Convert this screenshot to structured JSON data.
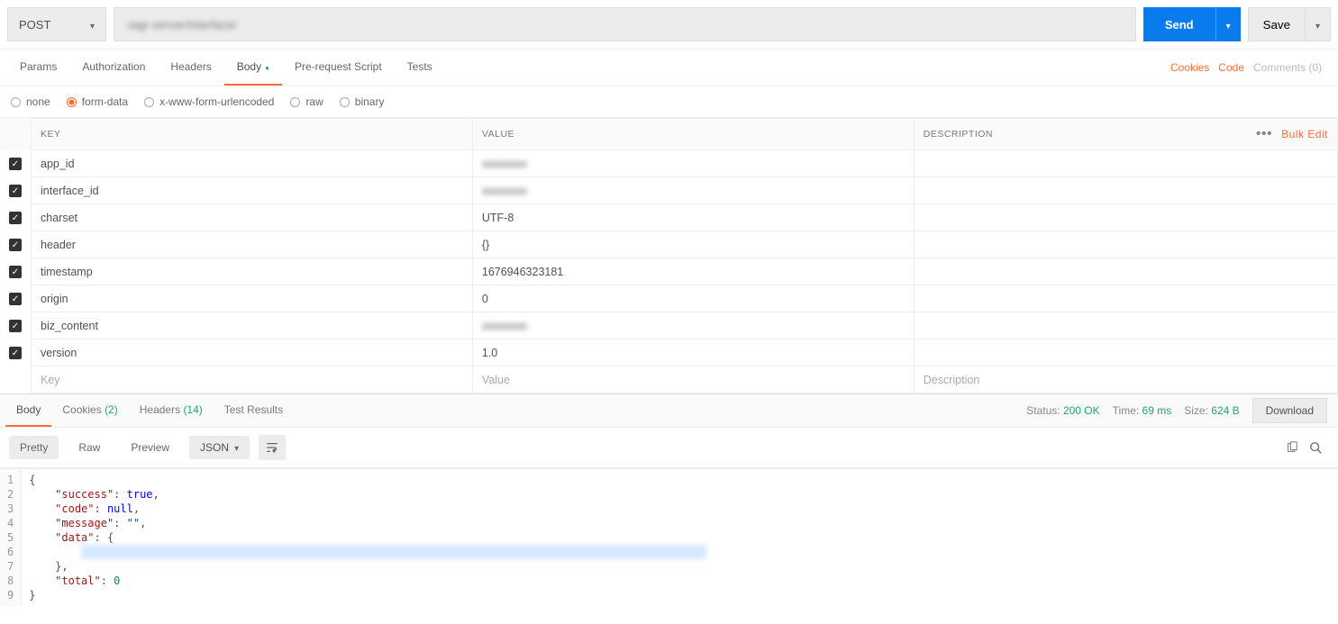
{
  "request": {
    "method": "POST",
    "url": "         -iagr-server/interface/",
    "send_label": "Send",
    "save_label": "Save"
  },
  "req_tabs": {
    "params": "Params",
    "authorization": "Authorization",
    "headers": "Headers",
    "body": "Body",
    "prerequest": "Pre-request Script",
    "tests": "Tests"
  },
  "req_right": {
    "cookies": "Cookies",
    "code": "Code",
    "comments": "Comments (0)"
  },
  "body_types": {
    "none": "none",
    "formdata": "form-data",
    "xwww": "x-www-form-urlencoded",
    "raw": "raw",
    "binary": "binary"
  },
  "kv_headers": {
    "key": "KEY",
    "value": "VALUE",
    "description": "DESCRIPTION",
    "bulk_edit": "Bulk Edit"
  },
  "kv_rows": [
    {
      "key": "app_id",
      "value": "",
      "blurval": true
    },
    {
      "key": "interface_id",
      "value": "",
      "blurval": true
    },
    {
      "key": "charset",
      "value": "UTF-8"
    },
    {
      "key": "header",
      "value": "{}"
    },
    {
      "key": "timestamp",
      "value": "1676946323181"
    },
    {
      "key": "origin",
      "value": "0"
    },
    {
      "key": "biz_content",
      "value": "",
      "blurval": true
    },
    {
      "key": "version",
      "value": "1.0"
    }
  ],
  "kv_placeholders": {
    "key": "Key",
    "value": "Value",
    "description": "Description"
  },
  "resp_tabs": {
    "body": "Body",
    "cookies": "Cookies",
    "cookies_count": "(2)",
    "headers": "Headers",
    "headers_count": "(14)",
    "tests": "Test Results"
  },
  "resp_status": {
    "status_label": "Status:",
    "status_value": "200 OK",
    "time_label": "Time:",
    "time_value": "69 ms",
    "size_label": "Size:",
    "size_value": "624 B",
    "download": "Download"
  },
  "view_modes": {
    "pretty": "Pretty",
    "raw": "Raw",
    "preview": "Preview",
    "json": "JSON"
  },
  "json_lines": [
    {
      "n": "1",
      "fold": true,
      "text": "{"
    },
    {
      "n": "2",
      "text": "    \"success\": true,"
    },
    {
      "n": "3",
      "text": "    \"code\": null,"
    },
    {
      "n": "4",
      "text": "    \"message\": \"\","
    },
    {
      "n": "5",
      "fold": true,
      "text": "    \"data\": {"
    },
    {
      "n": "6",
      "hl": true,
      "text": "                                                                                                "
    },
    {
      "n": "7",
      "text": "    },"
    },
    {
      "n": "8",
      "text": "    \"total\": 0"
    },
    {
      "n": "9",
      "text": "}"
    }
  ]
}
